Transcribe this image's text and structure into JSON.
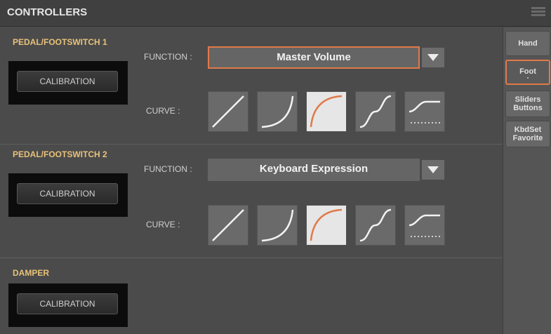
{
  "title": "CONTROLLERS",
  "sections": [
    {
      "title": "PEDAL/FOOTSWITCH 1",
      "calibration": "CALIBRATION",
      "function_label": "FUNCTION :",
      "function_value": "Master Volume",
      "curve_label": "CURVE :",
      "selected_curve": 3
    },
    {
      "title": "PEDAL/FOOTSWITCH 2",
      "calibration": "CALIBRATION",
      "function_label": "FUNCTION :",
      "function_value": "Keyboard Expression",
      "curve_label": "CURVE :",
      "selected_curve": 3
    },
    {
      "title": "DAMPER",
      "calibration": "CALIBRATION"
    }
  ],
  "tabs": [
    {
      "label": "Hand"
    },
    {
      "label": "Foot",
      "active": true
    },
    {
      "label": "Sliders Buttons"
    },
    {
      "label": "KbdSet Favorite"
    }
  ],
  "curve_icons": [
    "linear-curve-icon",
    "exponential-curve-icon",
    "logarithmic-curve-icon",
    "s-curve-icon",
    "switch-curve-icon"
  ],
  "colors": {
    "accent": "#e07a4a",
    "section_title": "#e8c27a",
    "selected_curve_bg": "#e6e6e6"
  }
}
